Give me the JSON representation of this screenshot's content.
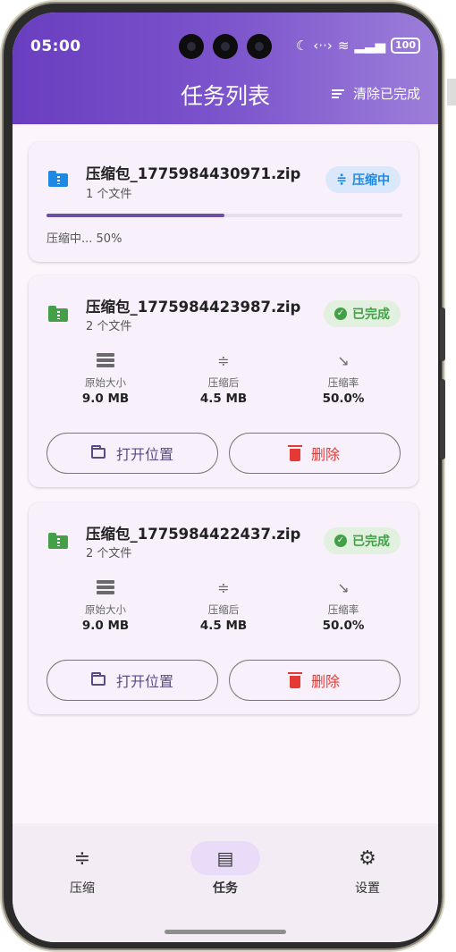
{
  "status_bar": {
    "time": "05:00",
    "battery": "100"
  },
  "header": {
    "title": "任务列表",
    "clear_label": "清除已完成"
  },
  "colors": {
    "accent": "#6a3ec0",
    "progress_blue": "#1e88e5",
    "done_green": "#43a047",
    "delete_red": "#e53935"
  },
  "tasks": [
    {
      "file_name": "压缩包_1775984430971.zip",
      "file_count": "1 个文件",
      "status": "压缩中",
      "progress": 0.5,
      "progress_text": "压缩中... 50%"
    },
    {
      "file_name": "压缩包_1775984423987.zip",
      "file_count": "2 个文件",
      "status": "已完成",
      "stats": {
        "original_label": "原始大小",
        "original_value": "9.0 MB",
        "compressed_label": "压缩后",
        "compressed_value": "4.5 MB",
        "ratio_label": "压缩率",
        "ratio_value": "50.0%"
      },
      "open_label": "打开位置",
      "delete_label": "删除"
    },
    {
      "file_name": "压缩包_1775984422437.zip",
      "file_count": "2 个文件",
      "status": "已完成",
      "stats": {
        "original_label": "原始大小",
        "original_value": "9.0 MB",
        "compressed_label": "压缩后",
        "compressed_value": "4.5 MB",
        "ratio_label": "压缩率",
        "ratio_value": "50.0%"
      },
      "open_label": "打开位置",
      "delete_label": "删除"
    }
  ],
  "nav": {
    "items": [
      {
        "label": "压缩",
        "icon": "compress-icon"
      },
      {
        "label": "任务",
        "icon": "task-list-icon",
        "active": true
      },
      {
        "label": "设置",
        "icon": "gear-icon"
      }
    ]
  }
}
